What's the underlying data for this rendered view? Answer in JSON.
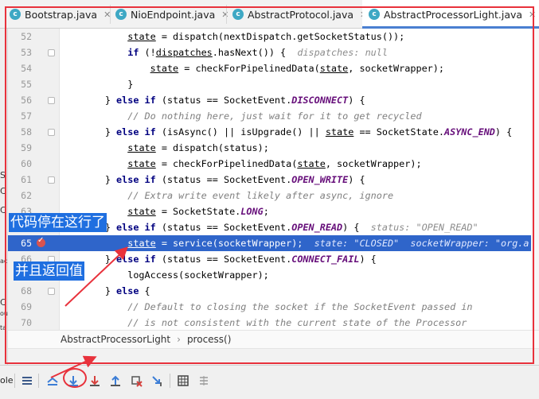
{
  "tabs": [
    {
      "label": "Bootstrap.java",
      "icon": "java-class-icon",
      "active": false
    },
    {
      "label": "NioEndpoint.java",
      "icon": "java-class-icon",
      "active": false
    },
    {
      "label": "AbstractProtocol.java",
      "icon": "java-class-icon",
      "active": false
    },
    {
      "label": "AbstractProcessorLight.java",
      "icon": "java-class-icon",
      "active": true
    }
  ],
  "editor": {
    "line_numbers": [
      "52",
      "53",
      "54",
      "55",
      "56",
      "57",
      "58",
      "59",
      "60",
      "61",
      "62",
      "63",
      "64",
      "65",
      "66",
      "67",
      "68",
      "69",
      "70"
    ],
    "current_line": "65",
    "lines": [
      [
        {
          "t": "            "
        },
        {
          "t": "state",
          "c": "ul"
        },
        {
          "t": " = dispatch(nextDispatch.getSocketStatus());"
        }
      ],
      [
        {
          "t": "            "
        },
        {
          "t": "if",
          "c": "kw"
        },
        {
          "t": " (!"
        },
        {
          "t": "dispatches",
          "c": "ul"
        },
        {
          "t": ".hasNext()) {  "
        },
        {
          "t": "dispatches: null",
          "c": "hint"
        }
      ],
      [
        {
          "t": "                "
        },
        {
          "t": "state",
          "c": "ul"
        },
        {
          "t": " = checkForPipelinedData("
        },
        {
          "t": "state",
          "c": "ul"
        },
        {
          "t": ", socketWrapper);"
        }
      ],
      [
        {
          "t": "            }"
        }
      ],
      [
        {
          "t": "        } "
        },
        {
          "t": "else if",
          "c": "kw"
        },
        {
          "t": " (status == SocketEvent."
        },
        {
          "t": "DISCONNECT",
          "c": "cnst"
        },
        {
          "t": ") {"
        }
      ],
      [
        {
          "t": "            "
        },
        {
          "t": "// Do nothing here, just wait for it to get recycled",
          "c": "cm"
        }
      ],
      [
        {
          "t": "        } "
        },
        {
          "t": "else if",
          "c": "kw"
        },
        {
          "t": " (isAsync() || isUpgrade() || "
        },
        {
          "t": "state",
          "c": "ul"
        },
        {
          "t": " == SocketState."
        },
        {
          "t": "ASYNC_END",
          "c": "cnst"
        },
        {
          "t": ") {"
        }
      ],
      [
        {
          "t": "            "
        },
        {
          "t": "state",
          "c": "ul"
        },
        {
          "t": " = dispatch(status);"
        }
      ],
      [
        {
          "t": "            "
        },
        {
          "t": "state",
          "c": "ul"
        },
        {
          "t": " = checkForPipelinedData("
        },
        {
          "t": "state",
          "c": "ul"
        },
        {
          "t": ", socketWrapper);"
        }
      ],
      [
        {
          "t": "        } "
        },
        {
          "t": "else if",
          "c": "kw"
        },
        {
          "t": " (status == SocketEvent."
        },
        {
          "t": "OPEN_WRITE",
          "c": "cnst"
        },
        {
          "t": ") {"
        }
      ],
      [
        {
          "t": "            "
        },
        {
          "t": "// Extra write event likely after async, ignore",
          "c": "cm"
        }
      ],
      [
        {
          "t": "            "
        },
        {
          "t": "state",
          "c": "ul"
        },
        {
          "t": " = SocketState."
        },
        {
          "t": "LONG",
          "c": "cnst"
        },
        {
          "t": ";"
        }
      ],
      [
        {
          "t": "        } "
        },
        {
          "t": "else if",
          "c": "kw"
        },
        {
          "t": " (status == SocketEvent."
        },
        {
          "t": "OPEN_READ",
          "c": "cnst"
        },
        {
          "t": ") {  "
        },
        {
          "t": "status: \"OPEN_READ\"",
          "c": "hint"
        }
      ],
      [
        {
          "t": "            "
        },
        {
          "t": "state",
          "c": "ul"
        },
        {
          "t": " = service(socketWrapper);  "
        },
        {
          "t": "state: \"CLOSED\"  socketWrapper: \"org.a",
          "c": "hint"
        }
      ],
      [
        {
          "t": "        } "
        },
        {
          "t": "else if",
          "c": "kw"
        },
        {
          "t": " (status == SocketEvent."
        },
        {
          "t": "CONNECT_FAIL",
          "c": "cnst"
        },
        {
          "t": ") {"
        }
      ],
      [
        {
          "t": "            logAccess(socketWrapper);"
        }
      ],
      [
        {
          "t": "        } "
        },
        {
          "t": "else",
          "c": "kw"
        },
        {
          "t": " {"
        }
      ],
      [
        {
          "t": "            "
        },
        {
          "t": "// Default to closing the socket if the SocketEvent passed in",
          "c": "cm"
        }
      ],
      [
        {
          "t": "            "
        },
        {
          "t": "// is not consistent with the current state of the Processor",
          "c": "cm"
        }
      ]
    ]
  },
  "breadcrumb": {
    "class_name": "AbstractProcessorLight",
    "method": "process()",
    "separator": "›"
  },
  "left_edge_chars": [
    "S",
    "C",
    "C",
    "ac",
    "C",
    "ou",
    "ta"
  ],
  "toolbar": {
    "left_text": "ole",
    "buttons": [
      {
        "name": "layout-icon"
      },
      {
        "name": "show-execution-point-icon"
      },
      {
        "name": "step-over-icon"
      },
      {
        "name": "step-into-icon"
      },
      {
        "name": "force-step-into-icon"
      },
      {
        "name": "step-out-icon"
      },
      {
        "name": "drop-frame-icon"
      },
      {
        "name": "run-to-cursor-icon"
      },
      {
        "name": "evaluate-expression-icon"
      },
      {
        "name": "trace-icon"
      }
    ]
  },
  "annotations": {
    "stopped_here": "代码停在这行了",
    "returns_value": "并且返回值"
  },
  "colors": {
    "keyword": "#000080",
    "comment": "#808080",
    "constant": "#660e7a",
    "highlight": "#2f65ca",
    "annotation_red": "#e8323c",
    "annotation_blue": "#1f6fe0"
  }
}
